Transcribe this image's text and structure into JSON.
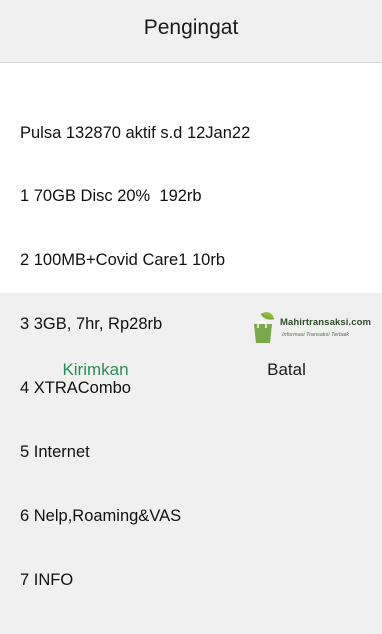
{
  "dialog": {
    "title": "Pengingat",
    "message_lines": [
      "Pulsa 132870 aktif s.d 12Jan22",
      "1 70GB Disc 20%  192rb",
      "2 100MB+Covid Care1 10rb",
      "3 3GB, 7hr, Rp28rb",
      "4 XTRACombo",
      "5 Internet",
      "6 Nelp,Roaming&VAS",
      "7 INFO"
    ],
    "send_label": "Kirimkan",
    "cancel_label": "Batal"
  },
  "watermark": {
    "name": "Mahirtransaksi.com",
    "tagline": "Informasi Transaksi Terbaik",
    "icon": "shopping-bag-leaf-logo"
  },
  "colors": {
    "dialog_background": "#f0f0f0",
    "message_background": "#ffffff",
    "send_button_text": "#2e8b57",
    "cancel_button_text": "#1a1a1a"
  }
}
